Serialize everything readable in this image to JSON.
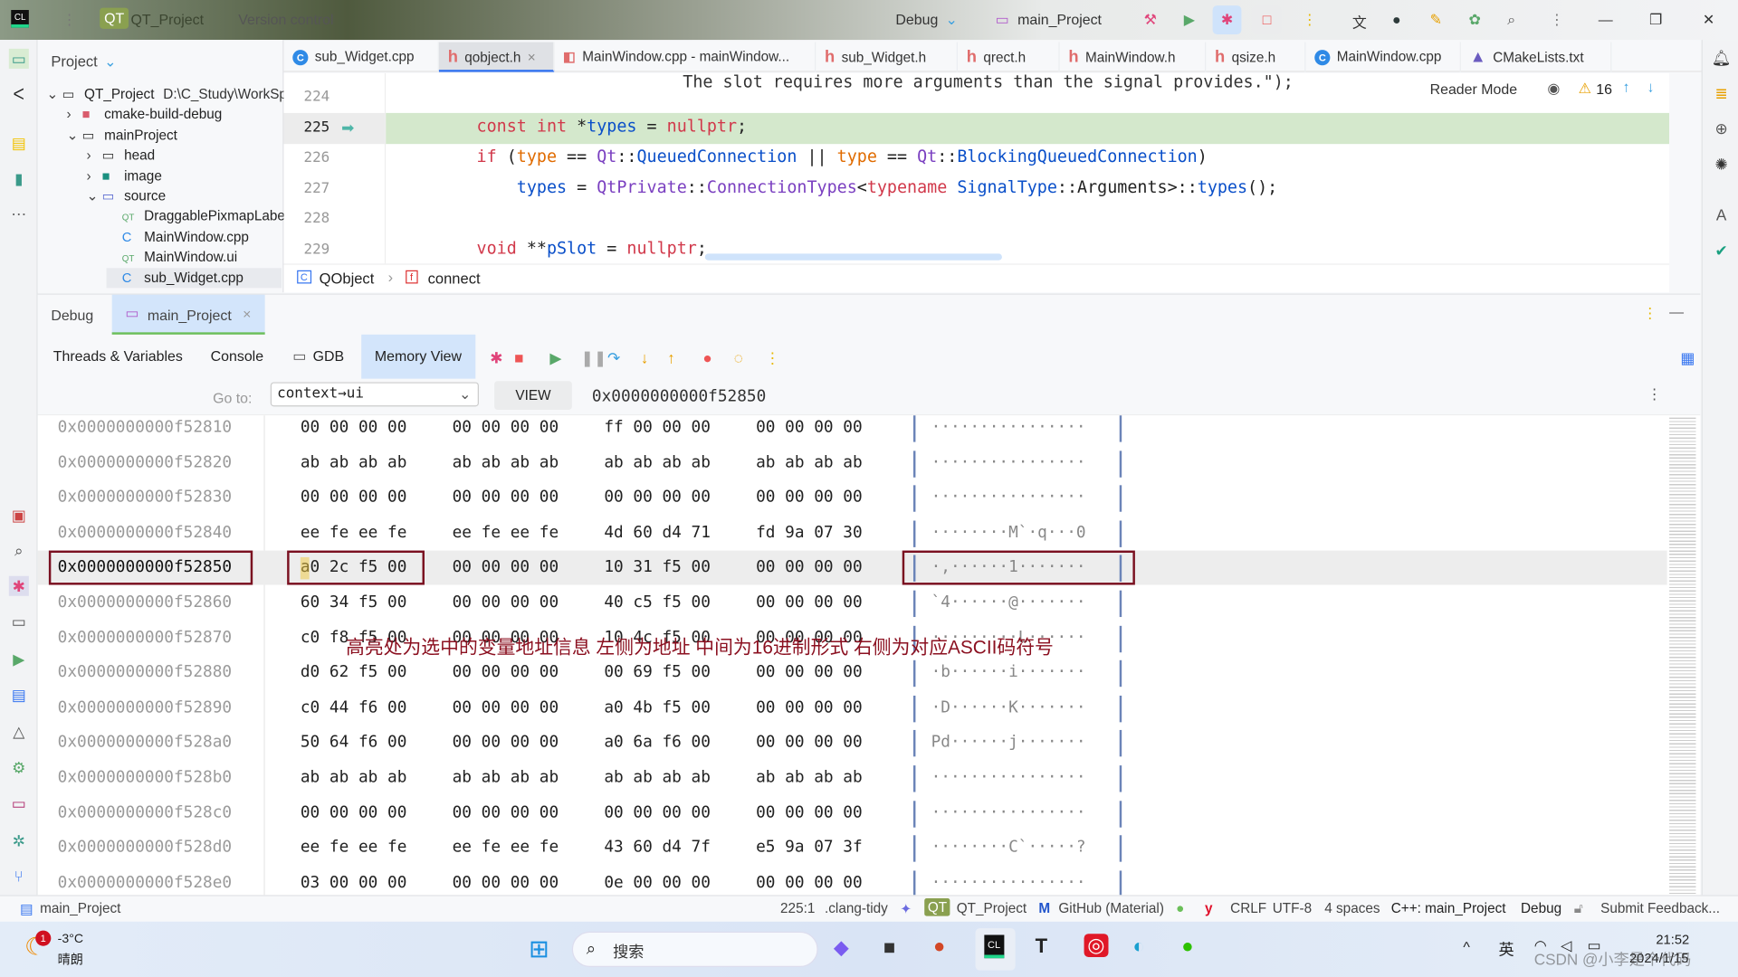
{
  "titlebar": {
    "project_badge": "QT",
    "project": "QT_Project",
    "vcs": "Version control",
    "config": "Debug",
    "run_target": "main_Project"
  },
  "project_panel": {
    "title": "Project",
    "tree": [
      {
        "label": "QT_Project",
        "extra": "D:\\C_Study\\WorkSp",
        "depth": 0,
        "icon": "folder-icon",
        "arrow": "v"
      },
      {
        "label": "cmake-build-debug",
        "depth": 1,
        "icon": "folder-red-icon",
        "arrow": ">"
      },
      {
        "label": "mainProject",
        "depth": 1,
        "icon": "folder-icon",
        "arrow": "v"
      },
      {
        "label": "head",
        "depth": 2,
        "icon": "folder-icon",
        "arrow": ">"
      },
      {
        "label": "image",
        "depth": 2,
        "icon": "folder-image-icon",
        "arrow": ">"
      },
      {
        "label": "source",
        "depth": 2,
        "icon": "folder-source-icon",
        "arrow": "v"
      },
      {
        "label": "DraggablePixmapLabel",
        "depth": 3,
        "icon": "qt-icon",
        "arrow": ""
      },
      {
        "label": "MainWindow.cpp",
        "depth": 3,
        "icon": "cpp-icon",
        "arrow": ""
      },
      {
        "label": "MainWindow.ui",
        "depth": 3,
        "icon": "qt-icon",
        "arrow": ""
      },
      {
        "label": "sub_Widget.cpp",
        "depth": 3,
        "icon": "cpp-icon",
        "arrow": "",
        "selected": true
      }
    ]
  },
  "editor_tabs": [
    {
      "label": "sub_Widget.cpp",
      "icon": "cpp"
    },
    {
      "label": "qobject.h",
      "icon": "h",
      "active": true
    },
    {
      "label": "MainWindow.cpp - mainWindow...",
      "icon": "ui"
    },
    {
      "label": "sub_Widget.h",
      "icon": "h"
    },
    {
      "label": "qrect.h",
      "icon": "h"
    },
    {
      "label": "MainWindow.h",
      "icon": "h"
    },
    {
      "label": "qsize.h",
      "icon": "h"
    },
    {
      "label": "MainWindow.cpp",
      "icon": "cpp"
    },
    {
      "label": "CMakeLists.txt",
      "icon": "cmake"
    }
  ],
  "editor": {
    "reader_mode": "Reader Mode",
    "warnings": "16",
    "top_partial": "The slot requires more arguments than the signal provides.\");",
    "lines": [
      {
        "n": "224",
        "code": ""
      },
      {
        "n": "225",
        "code": "const int *types = nullptr;",
        "current": true
      },
      {
        "n": "226",
        "code": "if (type == Qt::QueuedConnection || type == Qt::BlockingQueuedConnection)"
      },
      {
        "n": "227",
        "code": "    types = QtPrivate::ConnectionTypes<typename SignalType::Arguments>::types();"
      },
      {
        "n": "228",
        "code": ""
      },
      {
        "n": "229",
        "code": "void **pSlot = nullptr;"
      }
    ]
  },
  "breadcrumb": {
    "class": "QObject",
    "function": "connect"
  },
  "debug": {
    "title": "Debug",
    "session": "main_Project",
    "tabs": [
      "Threads & Variables",
      "Console",
      "GDB",
      "Memory View"
    ],
    "active_tab": "Memory View",
    "goto_label": "Go to:",
    "goto_value": "context→ui",
    "view_button": "VIEW",
    "current_address": "0x0000000000f52850"
  },
  "memory_rows": [
    {
      "addr": "0x0000000000f52810",
      "hex": [
        "00 00 00 00",
        "00 00 00 00",
        "ff 00 00 00",
        "00 00 00 00"
      ],
      "ascii": "················"
    },
    {
      "addr": "0x0000000000f52820",
      "hex": [
        "ab ab ab ab",
        "ab ab ab ab",
        "ab ab ab ab",
        "ab ab ab ab"
      ],
      "ascii": "················"
    },
    {
      "addr": "0x0000000000f52830",
      "hex": [
        "00 00 00 00",
        "00 00 00 00",
        "00 00 00 00",
        "00 00 00 00"
      ],
      "ascii": "················"
    },
    {
      "addr": "0x0000000000f52840",
      "hex": [
        "ee fe ee fe",
        "ee fe ee fe",
        "4d 60 d4 71",
        "fd 9a 07 30"
      ],
      "ascii": "········M`·q···0"
    },
    {
      "addr": "0x0000000000f52850",
      "hex": [
        "a0 2c f5 00",
        "00 00 00 00",
        "10 31 f5 00",
        "00 00 00 00"
      ],
      "ascii": "·,······1·······",
      "selected": true
    },
    {
      "addr": "0x0000000000f52860",
      "hex": [
        "60 34 f5 00",
        "00 00 00 00",
        "40 c5 f5 00",
        "00 00 00 00"
      ],
      "ascii": "`4······@·······"
    },
    {
      "addr": "0x0000000000f52870",
      "hex": [
        "c0 f8 f5 00",
        "00 00 00 00",
        "10 4c f5 00",
        "00 00 00 00"
      ],
      "ascii": "·········L······"
    },
    {
      "addr": "0x0000000000f52880",
      "hex": [
        "d0 62 f5 00",
        "00 00 00 00",
        "00 69 f5 00",
        "00 00 00 00"
      ],
      "ascii": "·b······i·······"
    },
    {
      "addr": "0x0000000000f52890",
      "hex": [
        "c0 44 f6 00",
        "00 00 00 00",
        "a0 4b f5 00",
        "00 00 00 00"
      ],
      "ascii": "·D······K·······"
    },
    {
      "addr": "0x0000000000f528a0",
      "hex": [
        "50 64 f6 00",
        "00 00 00 00",
        "a0 6a f6 00",
        "00 00 00 00"
      ],
      "ascii": "Pd······j·······"
    },
    {
      "addr": "0x0000000000f528b0",
      "hex": [
        "ab ab ab ab",
        "ab ab ab ab",
        "ab ab ab ab",
        "ab ab ab ab"
      ],
      "ascii": "················"
    },
    {
      "addr": "0x0000000000f528c0",
      "hex": [
        "00 00 00 00",
        "00 00 00 00",
        "00 00 00 00",
        "00 00 00 00"
      ],
      "ascii": "················"
    },
    {
      "addr": "0x0000000000f528d0",
      "hex": [
        "ee fe ee fe",
        "ee fe ee fe",
        "43 60 d4 7f",
        "e5 9a 07 3f"
      ],
      "ascii": "········C`·····?"
    },
    {
      "addr": "0x0000000000f528e0",
      "hex": [
        "03 00 00 00",
        "00 00 00 00",
        "0e 00 00 00",
        "00 00 00 00"
      ],
      "ascii": "················"
    }
  ],
  "annotation": "高亮处为选中的变量地址信息 左侧为地址 中间为16进制形式 右侧为对应ASCII码符号",
  "annotation_color": "#8b1020",
  "statusbar": {
    "project": "main_Project",
    "position": "225:1",
    "linter": ".clang-tidy",
    "qt_badge": "QT",
    "qt_project": "QT_Project",
    "theme": "GitHub (Material)",
    "line_sep": "CRLF",
    "encoding": "UTF-8",
    "indent": "4 spaces",
    "context": "C++: main_Project",
    "config": "Debug",
    "feedback": "Submit Feedback..."
  },
  "taskbar": {
    "weather_temp": "-3°C",
    "weather_desc": "晴朗",
    "weather_badge": "1",
    "search": "搜索",
    "ime": "英",
    "time": "21:52",
    "date": "2024/1/15",
    "watermark": "CSDN @小李是个代码"
  },
  "colors": {
    "accent": "#3574f0",
    "current_line": "#d4e8cc",
    "selection_box": "#7a1020"
  }
}
